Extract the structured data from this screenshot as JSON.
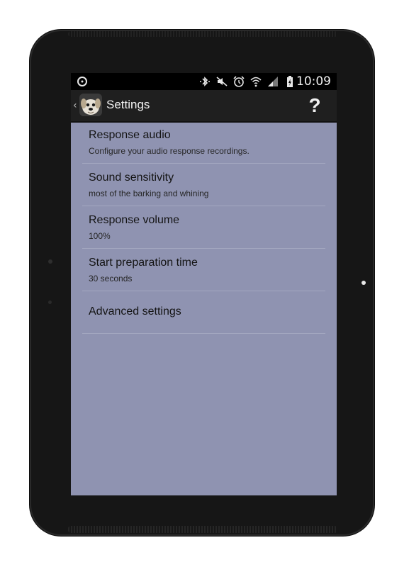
{
  "status_bar": {
    "time": "10:09",
    "icons": [
      "circle-o-icon",
      "bluetooth-icon",
      "mute-icon",
      "alarm-icon",
      "wifi-icon",
      "signal-icon",
      "battery-icon"
    ]
  },
  "action_bar": {
    "title": "Settings",
    "help_label": "?"
  },
  "settings": [
    {
      "title": "Response audio",
      "subtitle": "Configure your audio response recordings."
    },
    {
      "title": "Sound sensitivity",
      "subtitle": "most of the barking and whining"
    },
    {
      "title": "Response volume",
      "subtitle": "100%"
    },
    {
      "title": "Start preparation time",
      "subtitle": "30 seconds"
    },
    {
      "title": "Advanced settings",
      "subtitle": ""
    }
  ],
  "colors": {
    "screen_background": "#8f93b1",
    "action_bar": "#1f1f1f",
    "status_bar": "#000000"
  }
}
